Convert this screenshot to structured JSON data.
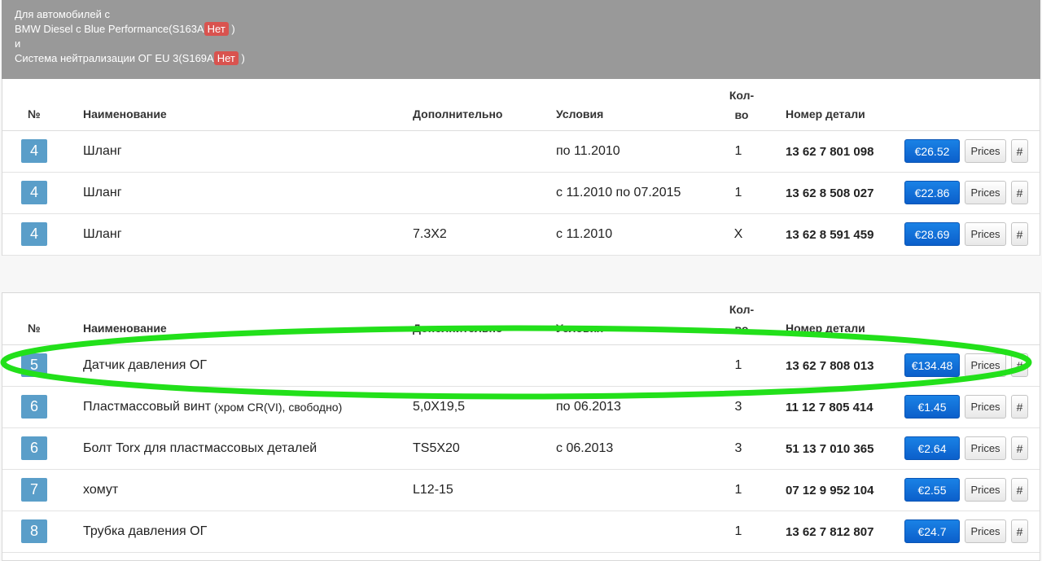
{
  "header": {
    "line1": "Для автомобилей с",
    "line2_prefix": "BMW Diesel с Blue Performance(S163A",
    "line2_badge": "Нет",
    "line2_suffix": ")",
    "line3": "и",
    "line4_prefix": "Система нейтрализации ОГ EU 3(S169A",
    "line4_badge": "Нет",
    "line4_suffix": ")"
  },
  "columns": {
    "num": "№",
    "name": "Наименование",
    "extra": "Дополнительно",
    "conditions": "Условия",
    "qty_line1": "Кол-",
    "qty_line2": "во",
    "part": "Номер детали"
  },
  "table1": [
    {
      "num": "4",
      "name": "Шланг",
      "name_small": "",
      "extra": "",
      "conditions": "по 11.2010",
      "qty": "1",
      "part": "13 62 7 801 098",
      "price": "€26.52",
      "prices_label": "Prices",
      "hash_label": "#"
    },
    {
      "num": "4",
      "name": "Шланг",
      "name_small": "",
      "extra": "",
      "conditions": "с 11.2010 по 07.2015",
      "qty": "1",
      "part": "13 62 8 508 027",
      "price": "€22.86",
      "prices_label": "Prices",
      "hash_label": "#"
    },
    {
      "num": "4",
      "name": "Шланг",
      "name_small": "",
      "extra": "7.3X2",
      "conditions": "с 11.2010",
      "qty": "X",
      "part": "13 62 8 591 459",
      "price": "€28.69",
      "prices_label": "Prices",
      "hash_label": "#"
    }
  ],
  "table2": [
    {
      "num": "5",
      "name": "Датчик давления ОГ",
      "name_small": "",
      "extra": "",
      "conditions": "",
      "qty": "1",
      "part": "13 62 7 808 013",
      "price": "€134.48",
      "prices_label": "Prices",
      "hash_label": "#"
    },
    {
      "num": "6",
      "name": "Пластмассовый винт",
      "name_small": "(хром CR(VI), свободно)",
      "extra": "5,0X19,5",
      "conditions": "по 06.2013",
      "qty": "3",
      "part": "11 12 7 805 414",
      "price": "€1.45",
      "prices_label": "Prices",
      "hash_label": "#"
    },
    {
      "num": "6",
      "name": "Болт Torx для пластмассовых деталей",
      "name_small": "",
      "extra": "TS5X20",
      "conditions": "с 06.2013",
      "qty": "3",
      "part": "51 13 7 010 365",
      "price": "€2.64",
      "prices_label": "Prices",
      "hash_label": "#"
    },
    {
      "num": "7",
      "name": "хомут",
      "name_small": "",
      "extra": "L12-15",
      "conditions": "",
      "qty": "1",
      "part": "07 12 9 952 104",
      "price": "€2.55",
      "prices_label": "Prices",
      "hash_label": "#"
    },
    {
      "num": "8",
      "name": "Трубка давления ОГ",
      "name_small": "",
      "extra": "",
      "conditions": "",
      "qty": "1",
      "part": "13 62 7 812 807",
      "price": "€24.7",
      "prices_label": "Prices",
      "hash_label": "#"
    }
  ],
  "colors": {
    "header_bg": "#999999",
    "badge_no": "#d9534f",
    "num_badge": "#5a9ec9",
    "price_button": "#0b6fd6",
    "highlight_ellipse": "#22e01a"
  }
}
